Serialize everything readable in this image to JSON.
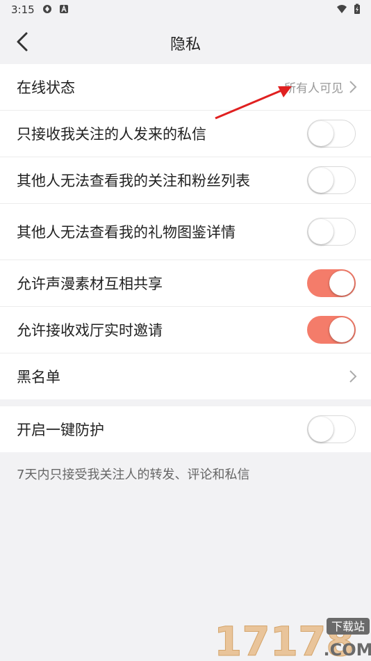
{
  "status_bar": {
    "time": "3:15"
  },
  "header": {
    "title": "隐私"
  },
  "settings_main": [
    {
      "label": "在线状态",
      "type": "link",
      "value": "所有人可见"
    },
    {
      "label": "只接收我关注的人发来的私信",
      "type": "toggle",
      "on": false
    },
    {
      "label": "其他人无法查看我的关注和粉丝列表",
      "type": "toggle",
      "on": false
    },
    {
      "label": "其他人无法查看我的礼物图鉴详情",
      "type": "toggle",
      "on": false
    },
    {
      "label": "允许声漫素材互相共享",
      "type": "toggle",
      "on": true
    },
    {
      "label": "允许接收戏厅实时邀请",
      "type": "toggle",
      "on": true
    },
    {
      "label": "黑名单",
      "type": "link"
    }
  ],
  "protection": {
    "label": "开启一键防护",
    "on": false,
    "note": "7天内只接受我关注人的转发、评论和私信"
  },
  "watermark": {
    "text": "17178",
    "badge": "下载站",
    "suffix": ".COM"
  },
  "colors": {
    "accent": "#f47c6a",
    "background": "#f2f2f4",
    "annotation_arrow": "#e02020"
  }
}
